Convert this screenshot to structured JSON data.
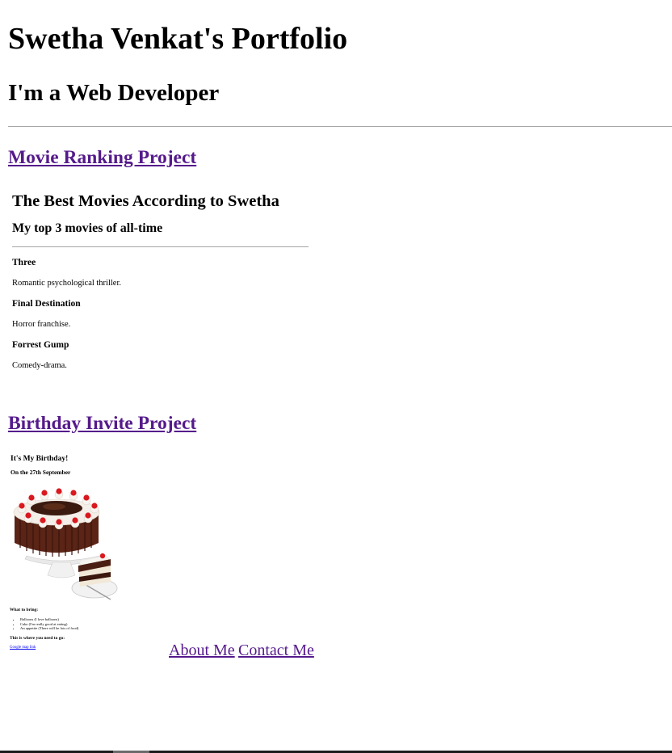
{
  "header": {
    "title": "Swetha Venkat's Portfolio",
    "subtitle": "I'm a Web Developer"
  },
  "movie_project": {
    "link_label": "Movie Ranking Project",
    "title": "The Best Movies According to Swetha",
    "subtitle": "My top 3 movies of all-time",
    "movies": [
      {
        "name": "Three",
        "desc": "Romantic psychological thriller."
      },
      {
        "name": "Final Destination",
        "desc": "Horror franchise."
      },
      {
        "name": "Forrest Gump",
        "desc": "Comedy-drama."
      }
    ]
  },
  "birthday_project": {
    "link_label": "Birthday Invite Project",
    "title": "It's My Birthday!",
    "date": "On the 27th September",
    "bring_heading": "What to bring:",
    "bring_items": [
      "Balloons (I love balloons)",
      "Cake (I'm really good at eating)",
      "An appetite (There will be lots of food)"
    ],
    "where_heading": "This is where you need to go:",
    "map_link": "Google map link"
  },
  "nav": {
    "about": "About Me",
    "contact": "Contact Me"
  },
  "colors": {
    "visited_link": "#551a8b",
    "link": "#0000ee",
    "rule": "#a6a6a6"
  }
}
